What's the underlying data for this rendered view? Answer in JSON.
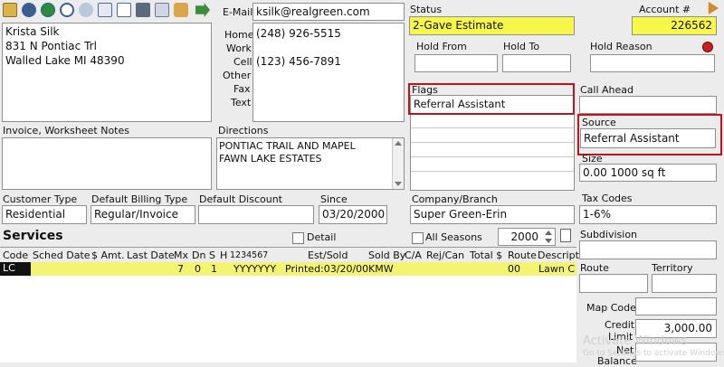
{
  "customer": {
    "name": "Krista Silk",
    "address1": "831 N Pontiac Trl",
    "city_line": "Walled Lake MI  48390"
  },
  "contact": {
    "email_label": "E-Mail",
    "email": "ksilk@realgreen.com",
    "home_label": "Home",
    "work_label": "Work",
    "cell_label": "Cell",
    "other_label": "Other",
    "fax_label": "Fax",
    "text_label": "Text",
    "home_phone": "(248) 926-5515",
    "cell_phone": "(123) 456-7891"
  },
  "status": {
    "label": "Status",
    "value": "2-Gave Estimate"
  },
  "account": {
    "label": "Account #",
    "value": "226562"
  },
  "hold": {
    "from_label": "Hold From",
    "to_label": "Hold To",
    "reason_label": "Hold Reason"
  },
  "flags": {
    "label": "Flags",
    "items": [
      "Referral Assistant"
    ]
  },
  "call_ahead": {
    "label": "Call Ahead"
  },
  "source": {
    "label": "Source",
    "value": "Referral Assistant"
  },
  "size": {
    "label": "Size",
    "value": "0.00 1000 sq ft"
  },
  "notes": {
    "label": "Invoice, Worksheet Notes"
  },
  "directions": {
    "label": "Directions",
    "line1": "PONTIAC TRAIL AND MAPEL",
    "line2": "FAWN LAKE ESTATES"
  },
  "customer_type": {
    "label": "Customer Type",
    "value": "Residential"
  },
  "billing_type": {
    "label": "Default Billing Type",
    "value": "Regular/Invoice"
  },
  "discount": {
    "label": "Default Discount"
  },
  "since": {
    "label": "Since",
    "value": "03/20/2000"
  },
  "company": {
    "label": "Company/Branch",
    "value": "Super Green-Erin"
  },
  "tax": {
    "label": "Tax Codes",
    "value": "1-6%"
  },
  "subdivision": {
    "label": "Subdivision"
  },
  "route": {
    "label": "Route"
  },
  "territory": {
    "label": "Territory"
  },
  "map_code": {
    "label": "Map Code"
  },
  "credit_limit": {
    "label1": "Credit",
    "label2": "Limit",
    "value": "3,000.00"
  },
  "net_balance": {
    "label1": "Net",
    "label2": "Balance"
  },
  "services": {
    "title": "Services",
    "detail_label": "Detail",
    "all_seasons_label": "All Seasons",
    "year": "2000",
    "headers": {
      "code": "Code",
      "sched_date": "Sched Date",
      "amt": "$ Amt.",
      "last_date": "Last Date",
      "mx": "Mx",
      "dn": "Dn",
      "s": "S",
      "h": "H",
      "days": "1234567",
      "est_sold": "Est/Sold",
      "sold_by": "Sold By",
      "ca": "C/A",
      "rej_can": "Rej/Can",
      "total": "Total $",
      "route": "Route",
      "descript": "Descript"
    },
    "rows": [
      {
        "code": "LC",
        "mx": "7",
        "dn": "0",
        "s": "1",
        "days": "YYYYYYY",
        "est_sold": "Printed:03/20/00",
        "sold_by": "KMW",
        "route": "00",
        "descript": "Lawn C"
      }
    ]
  },
  "watermark": {
    "line1": "Activate Windows",
    "line2": "Go to Settings to activate Windows."
  },
  "toolbar_icons": [
    "folder-icon",
    "binoculars-icon",
    "globe-icon",
    "zoom-icon",
    "cloud-icon",
    "copy-icon",
    "dollar-doc-icon",
    "calculator-icon",
    "clipboard-icon",
    "tools-icon",
    "arrow-right-icon"
  ],
  "colors": {
    "highlight": "#f7f74a",
    "red_outline": "#c0141c",
    "panel": "#ececec"
  }
}
